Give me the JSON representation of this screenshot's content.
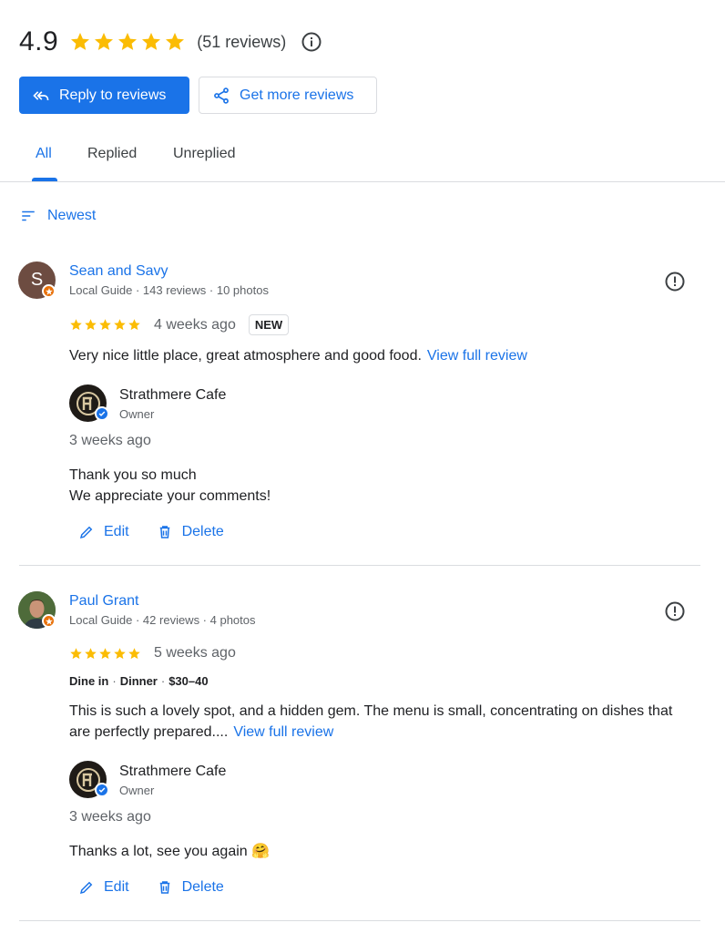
{
  "summary": {
    "rating": "4.9",
    "stars": 5,
    "count": "(51 reviews)",
    "info_icon": "info-icon"
  },
  "actions": {
    "reply_label": "Reply to reviews",
    "more_label": "Get more reviews"
  },
  "tabs": [
    {
      "label": "All",
      "active": true
    },
    {
      "label": "Replied",
      "active": false
    },
    {
      "label": "Unreplied",
      "active": false
    }
  ],
  "sort": {
    "label": "Newest"
  },
  "reviews": [
    {
      "avatar_letter": "S",
      "name": "Sean and Savy",
      "meta": "Local Guide · 143 reviews · 10 photos",
      "rating": 5,
      "time": "4 weeks ago",
      "badge": "NEW",
      "text": "Very nice little place, great atmosphere and good food.",
      "view_full": "View full review",
      "reply": {
        "owner_name": "Strathmere Cafe",
        "owner_role": "Owner",
        "time": "3 weeks ago",
        "line1": "Thank you so much",
        "line2": "We appreciate your comments!"
      }
    },
    {
      "name": "Paul Grant",
      "meta": "Local Guide · 42 reviews · 4 photos",
      "rating": 5,
      "time": "5 weeks ago",
      "details": [
        "Dine in",
        "Dinner",
        "$30–40"
      ],
      "text_line1": "This is such a lovely spot, and a hidden gem. The menu is small, concentrating on dishes that",
      "text_line2": "are perfectly prepared....",
      "view_full": "View full review",
      "reply": {
        "owner_name": "Strathmere Cafe",
        "owner_role": "Owner",
        "time": "3 weeks ago",
        "line1": "Thanks a lot, see you again 🤗"
      }
    }
  ],
  "reply_actions": {
    "edit_label": "Edit",
    "delete_label": "Delete"
  },
  "colors": {
    "accent": "#1a73e8",
    "star": "#fbbc04",
    "guide_badge": "#e8710a"
  }
}
